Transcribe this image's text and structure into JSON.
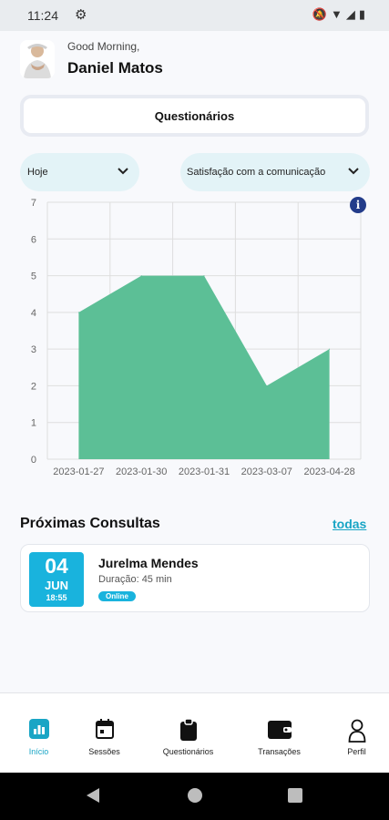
{
  "status_bar": {
    "time": "11:24"
  },
  "header": {
    "greeting": "Good Morning,",
    "user_name": "Daniel Matos"
  },
  "questionnaire_card": {
    "label": "Questionários"
  },
  "filters": {
    "period": {
      "selected": "Hoje"
    },
    "metric": {
      "selected": "Satisfação com a comunicação"
    }
  },
  "chart_data": {
    "type": "area",
    "x": [
      "2023-01-27",
      "2023-01-30",
      "2023-01-31",
      "2023-03-07",
      "2023-04-28"
    ],
    "values": [
      4,
      5,
      5,
      2,
      3
    ],
    "ylim": [
      0,
      7
    ],
    "yticks": [
      "0",
      "1",
      "2",
      "3",
      "4",
      "5",
      "6",
      "7"
    ],
    "grid": true,
    "color": "#5cbf96"
  },
  "upcoming": {
    "title": "Próximas Consultas",
    "link": "todas",
    "items": [
      {
        "day": "04",
        "month": "JUN",
        "time": "18:55",
        "name": "Jurelma Mendes",
        "duration": "Duração: 45 min",
        "badge": "Online"
      }
    ]
  },
  "tabs": [
    {
      "label": "Início",
      "icon": "dashboard-icon",
      "active": true
    },
    {
      "label": "Sessões",
      "icon": "calendar-icon"
    },
    {
      "label": "Questionários",
      "icon": "clipboard-icon"
    },
    {
      "label": "Transações",
      "icon": "wallet-icon"
    },
    {
      "label": "Perfil",
      "icon": "person-icon"
    }
  ],
  "colors": {
    "accent": "#19a5c5",
    "chart_fill": "#5cbf96",
    "info": "#233c8a"
  }
}
